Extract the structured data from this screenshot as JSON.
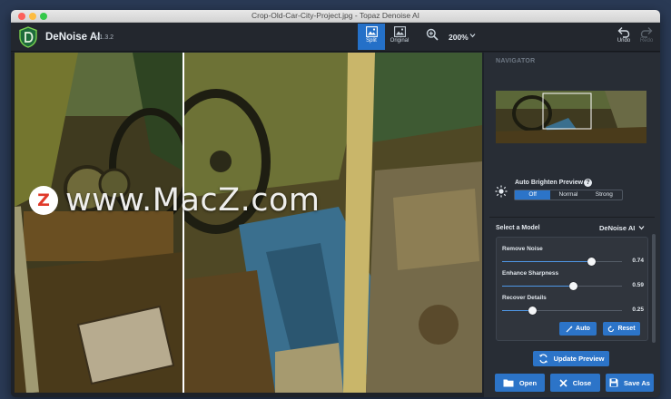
{
  "window": {
    "title": "Crop-Old-Car-City-Project.jpg - Topaz Denoise AI"
  },
  "app": {
    "name": "DeNoise AI",
    "version": "v1.3.2"
  },
  "toolbar": {
    "split_label": "Split",
    "original_label": "Original",
    "zoom": "200%",
    "undo_label": "Undo",
    "redo_label": "Redo"
  },
  "navigator": {
    "title": "NAVIGATOR"
  },
  "auto_brighten": {
    "label": "Auto Brighten Preview",
    "options": [
      "Off",
      "Normal",
      "Strong"
    ],
    "selected": "Off"
  },
  "model": {
    "label": "Select a Model",
    "value": "DeNoise AI"
  },
  "sliders": [
    {
      "label": "Remove Noise",
      "value": "0.74",
      "level": 0.74
    },
    {
      "label": "Enhance Sharpness",
      "value": "0.59",
      "level": 0.59
    },
    {
      "label": "Recover Details",
      "value": "0.25",
      "level": 0.25
    }
  ],
  "buttons": {
    "auto": "Auto",
    "reset": "Reset",
    "update_preview": "Update Preview",
    "open": "Open",
    "close": "Close",
    "save_as": "Save As"
  },
  "watermark": {
    "badge": "Z",
    "text": "www.MacZ.com"
  },
  "colors": {
    "accent": "#2c74c8",
    "panel": "#282d35",
    "toolbar": "#23272e"
  }
}
